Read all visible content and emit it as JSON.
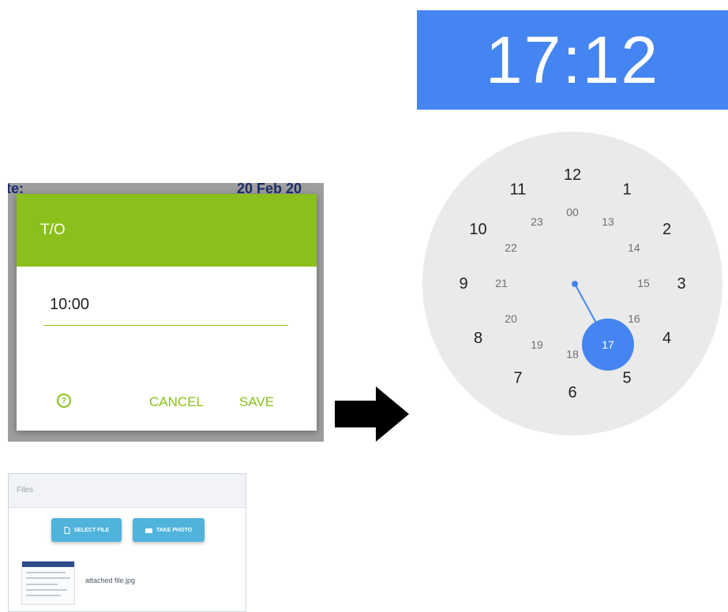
{
  "dialog": {
    "title": "T/O",
    "time_value": "10:00",
    "help_icon_glyph": "?",
    "cancel_label": "CANCEL",
    "save_label": "SAVE",
    "accent_color": "#8bbf1b",
    "background_fragments": [
      "te:",
      "20 Feb 20"
    ]
  },
  "clock": {
    "header_time": "17:12",
    "header_color": "#4585f1",
    "selected_hour": "17",
    "outer_hours": [
      "12",
      "1",
      "2",
      "3",
      "4",
      "5",
      "6",
      "7",
      "8",
      "9",
      "10",
      "11"
    ],
    "inner_hours": [
      "00",
      "13",
      "14",
      "15",
      "16",
      "17",
      "18",
      "19",
      "20",
      "21",
      "22",
      "23"
    ]
  },
  "files": {
    "header_title": "Files",
    "select_file_label": "SELECT FILE",
    "take_photo_label": "TAKE PHOTO",
    "attached_file_name": "attached file.jpg",
    "button_color": "#4fb3dc"
  }
}
